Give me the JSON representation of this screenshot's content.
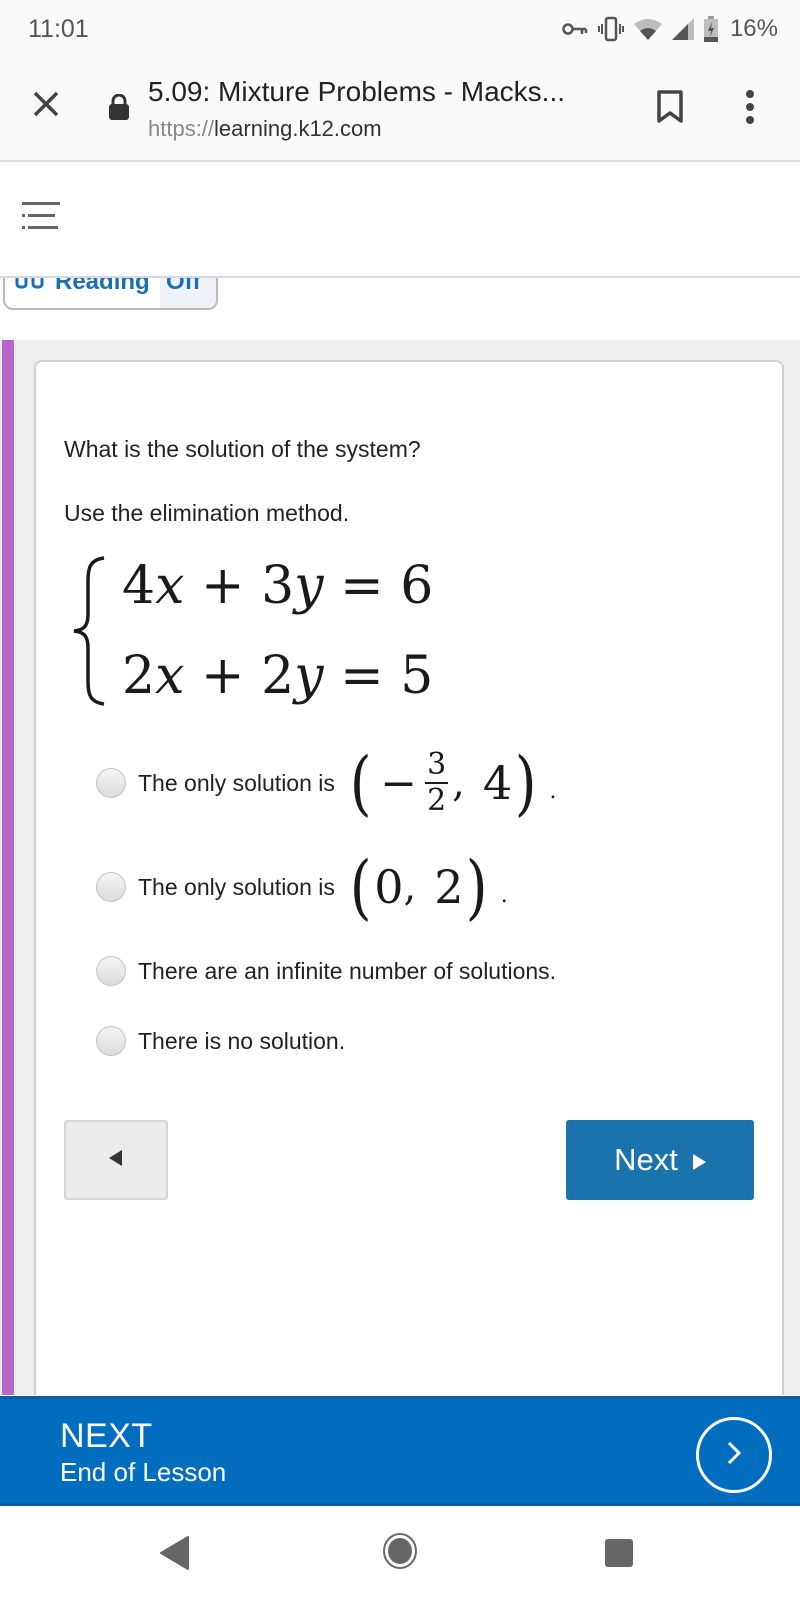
{
  "status_bar": {
    "time": "11:01",
    "icons": [
      "vpn-key-icon",
      "vibrate-icon",
      "wifi-icon",
      "cell-signal-icon",
      "battery-charging-icon"
    ],
    "battery_percent": "16%"
  },
  "browser": {
    "title": "5.09: Mixture Problems - Macks...",
    "url_scheme": "https://",
    "url_host": "learning.k12.com",
    "icons": {
      "close": "close-icon",
      "secure": "lock-icon",
      "bookmark": "bookmark-icon",
      "menu": "more-vert-icon"
    }
  },
  "app_nav": {
    "menu_icon": "list-menu-icon"
  },
  "reading_toggle": {
    "label": "Reading",
    "state": "Off"
  },
  "question": {
    "prompt": "What is the solution of the system?",
    "instruction": "Use the elimination method.",
    "system": [
      {
        "a": "4",
        "x": "x",
        "op": "+",
        "b": "3",
        "y": "y",
        "eq": "=",
        "c": "6"
      },
      {
        "a": "2",
        "x": "x",
        "op": "+",
        "b": "2",
        "y": "y",
        "eq": "=",
        "c": "5"
      }
    ],
    "options": [
      {
        "text": "The only solution is",
        "math": {
          "x_sign": "−",
          "x_num": "3",
          "x_den": "2",
          "y": "4"
        },
        "trailing": ".",
        "selected": false
      },
      {
        "text": "The only solution is",
        "math": {
          "x": "0",
          "y": "2"
        },
        "trailing": ".",
        "selected": false
      },
      {
        "text": "There are an infinite number of solutions.",
        "selected": false
      },
      {
        "text": "There is no solution.",
        "selected": false
      }
    ],
    "math_symbols": {
      "open": "(",
      "close": ")",
      "comma": ","
    }
  },
  "navigation": {
    "prev_icon": "triangle-left-icon",
    "next_label": "Next",
    "next_icon": "triangle-right-icon"
  },
  "lesson_footer": {
    "label": "NEXT",
    "sublabel": "End of Lesson",
    "icon": "chevron-right-circle-icon"
  },
  "colors": {
    "accent_stripe": "#b866cc",
    "primary_blue": "#1a73ad",
    "footer_blue": "#006dbf",
    "link_blue": "#1a6fb3"
  }
}
